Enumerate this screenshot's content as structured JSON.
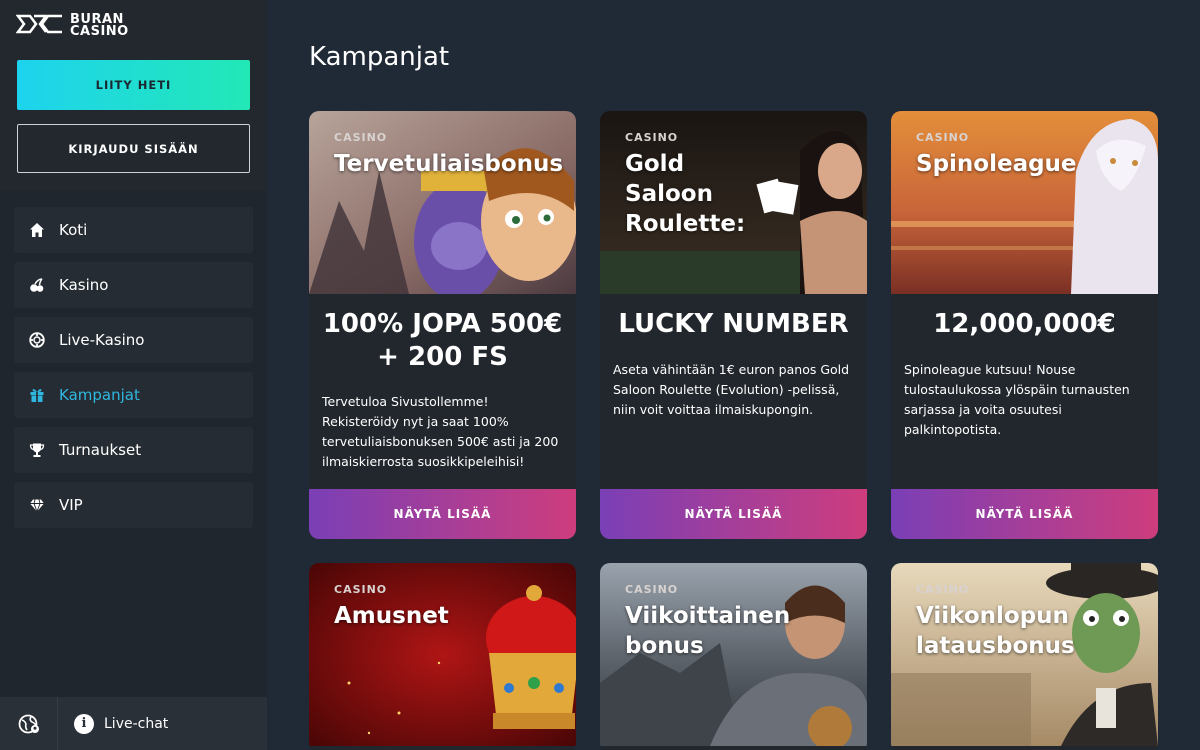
{
  "brand": {
    "line1": "BURAN",
    "line2": "CASINO"
  },
  "auth": {
    "join_label": "LIITY HETI",
    "login_label": "KIRJAUDU SISÄÄN"
  },
  "nav": [
    {
      "label": "Koti",
      "icon": "home-icon"
    },
    {
      "label": "Kasino",
      "icon": "cherries-icon"
    },
    {
      "label": "Live-Kasino",
      "icon": "chip-icon"
    },
    {
      "label": "Kampanjat",
      "icon": "gift-icon",
      "active": true
    },
    {
      "label": "Turnaukset",
      "icon": "trophy-icon"
    },
    {
      "label": "VIP",
      "icon": "diamond-icon"
    }
  ],
  "footer": {
    "livechat_label": "Live-chat",
    "info_glyph": "i"
  },
  "page": {
    "title": "Kampanjat"
  },
  "promotions": [
    {
      "tag": "CASINO",
      "title": "Tervetuliaisbonus",
      "headline": "100% JOPA 500€ + 200 FS",
      "text": "Tervetuloa Sivustollemme! Rekisteröidy nyt ja saat 100% tervetuliaisbonuksen 500€ asti ja 200 ilmaiskierrosta suosikkipeleihisi!",
      "button": "NÄYTÄ LISÄÄ"
    },
    {
      "tag": "CASINO",
      "title": "Gold Saloon Roulette:",
      "headline": "LUCKY NUMBER",
      "text": "Aseta vähintään 1€ euron panos Gold Saloon Roulette (Evolution) -pelissä, niin voit voittaa ilmaiskupongin.",
      "button": "NÄYTÄ LISÄÄ"
    },
    {
      "tag": "CASINO",
      "title": "Spinoleague",
      "headline": "12,000,000€",
      "text": "Spinoleague kutsuu! Nouse tulostaulukossa ylöspäin turnausten sarjassa ja voita osuutesi palkintopotista.",
      "button": "NÄYTÄ LISÄÄ"
    },
    {
      "tag": "CASINO",
      "title": "Amusnet"
    },
    {
      "tag": "CASINO",
      "title": "Viikoittainen bonus"
    },
    {
      "tag": "CASINO",
      "title": "Viikonlopun latausbonus"
    }
  ],
  "colors": {
    "accent": "#2fb7e0",
    "join_gradient_start": "#1ed3ee",
    "join_gradient_end": "#22e8b6",
    "cta_gradient_start": "#7a3fb6",
    "cta_gradient_end": "#ce3d7d"
  }
}
